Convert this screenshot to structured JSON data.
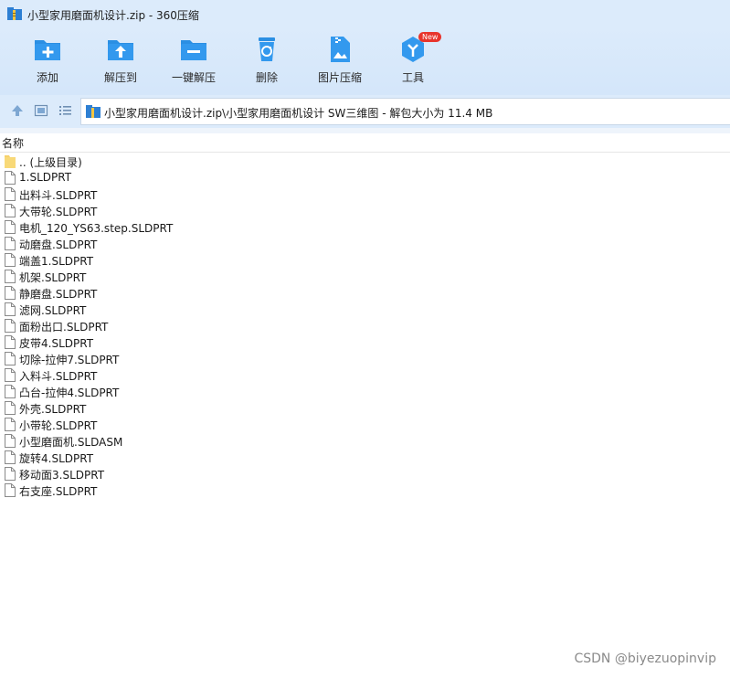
{
  "window": {
    "title": "小型家用磨面机设计.zip - 360压缩"
  },
  "toolbar": {
    "items": [
      {
        "label": "添加",
        "icon": "add-icon"
      },
      {
        "label": "解压到",
        "icon": "extract-to-icon"
      },
      {
        "label": "一键解压",
        "icon": "one-click-extract-icon"
      },
      {
        "label": "删除",
        "icon": "delete-icon"
      },
      {
        "label": "图片压缩",
        "icon": "image-compress-icon"
      },
      {
        "label": "工具",
        "icon": "tools-icon",
        "badge": "New"
      }
    ],
    "accent": "#2b8fe3"
  },
  "nav": {
    "path": "小型家用磨面机设计.zip\\小型家用磨面机设计 SW三维图 - 解包大小为 11.4 MB"
  },
  "list": {
    "header": "名称",
    "parent_label": ".. (上级目录)",
    "files": [
      "1.SLDPRT",
      "出料斗.SLDPRT",
      "大带轮.SLDPRT",
      "电机_120_YS63.step.SLDPRT",
      "动磨盘.SLDPRT",
      "端盖1.SLDPRT",
      "机架.SLDPRT",
      "静磨盘.SLDPRT",
      "滤网.SLDPRT",
      "面粉出口.SLDPRT",
      "皮带4.SLDPRT",
      "切除-拉伸7.SLDPRT",
      "入料斗.SLDPRT",
      "凸台-拉伸4.SLDPRT",
      "外壳.SLDPRT",
      "小带轮.SLDPRT",
      "小型磨面机.SLDASM",
      "旋转4.SLDPRT",
      "移动面3.SLDPRT",
      "右支座.SLDPRT"
    ]
  },
  "watermark": "CSDN @biyezuopinvip"
}
